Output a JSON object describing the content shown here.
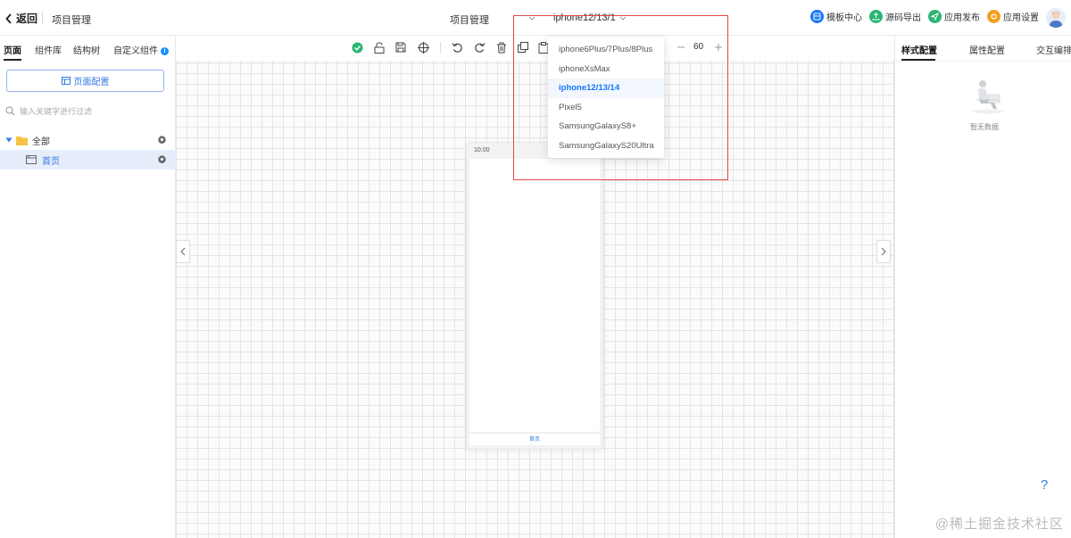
{
  "header": {
    "back_label": "返回",
    "project_name": "项目管理",
    "center_title": "项目管理",
    "device_selected": "iphone12/13/14",
    "actions": [
      {
        "label": "模板中心",
        "color": "#1677ff"
      },
      {
        "label": "源码导出",
        "color": "#2bb673"
      },
      {
        "label": "应用发布",
        "color": "#2bb673"
      },
      {
        "label": "应用设置",
        "color": "#f0a020"
      }
    ]
  },
  "sidebar": {
    "tabs": [
      "页面",
      "组件库",
      "结构树",
      "自定义组件"
    ],
    "page_config_label": "页面配置",
    "search_placeholder": "输入关键字进行过滤",
    "tree": [
      {
        "label": "全部"
      },
      {
        "label": "首页"
      }
    ]
  },
  "toolbar": {
    "zoom_value": "60"
  },
  "phone": {
    "status_time": "10:00",
    "tab_label": "首页"
  },
  "device_dropdown": {
    "items": [
      "iphone6Plus/7Plus/8Plus",
      "iphoneXsMax",
      "iphone12/13/14",
      "Pixel5",
      "SamsungGalaxyS8+",
      "SamsungGalaxyS20Ultra"
    ],
    "selected_index": 2
  },
  "right_panel": {
    "tabs": [
      "样式配置",
      "属性配置",
      "交互编排"
    ],
    "empty_text": "暂无数据",
    "help_label": "?"
  },
  "watermark": "@稀土掘金技术社区",
  "colors": {
    "accent": "#1677ff",
    "highlight": "#e04848"
  }
}
